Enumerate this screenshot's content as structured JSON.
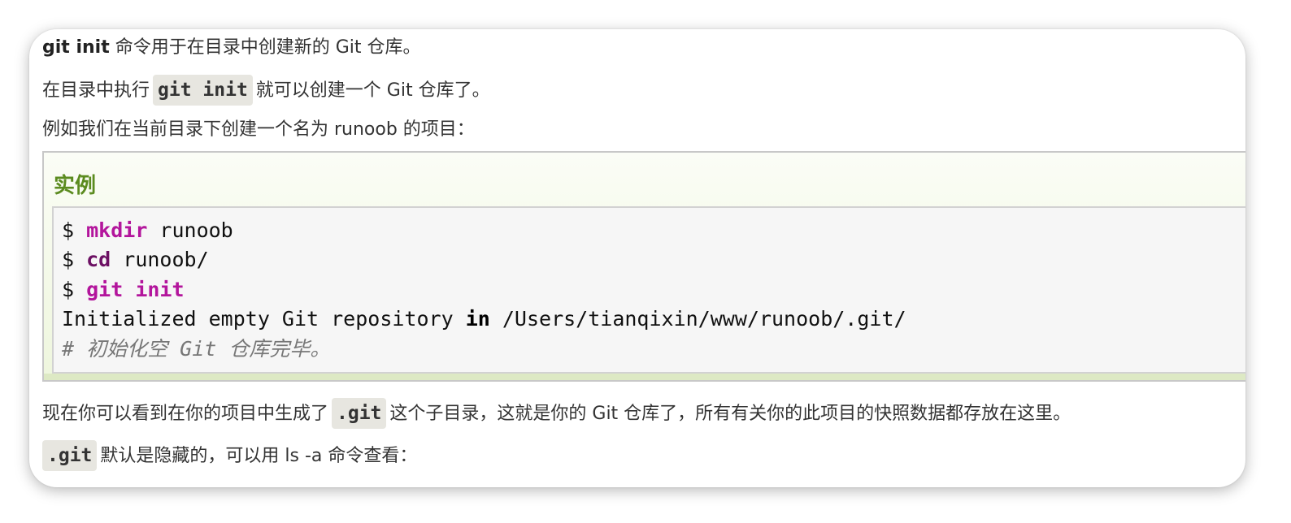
{
  "paragraphs": {
    "p1": {
      "bold": "git init",
      "text": " 命令用于在目录中创建新的 Git 仓库。"
    },
    "p2": {
      "before": "在目录中执行",
      "code": "git init",
      "after": "就可以创建一个 Git 仓库了。"
    },
    "p3": {
      "text": "例如我们在当前目录下创建一个名为 runoob 的项目："
    },
    "p4": {
      "before": "现在你可以看到在你的项目中生成了",
      "code": ".git",
      "after": "这个子目录，这就是你的 Git 仓库了，所有有关你的此项目的快照数据都存放在这里。"
    },
    "p5": {
      "code": ".git",
      "after": "默认是隐藏的，可以用 ls -a 命令查看："
    }
  },
  "example": {
    "title": "实例",
    "lines": [
      {
        "prompt": "$ ",
        "cmd": "mkdir",
        "rest": " runoob"
      },
      {
        "prompt": "$ ",
        "cmd": "cd",
        "rest": " runoob/"
      },
      {
        "prompt": "$ ",
        "cmd": "git init",
        "rest": ""
      },
      {
        "before": "Initialized empty Git repository ",
        "kw": "in",
        "after": " /Users/tianqixin/www/runoob/.git/"
      },
      {
        "comment": "# 初始化空 Git 仓库完毕。"
      }
    ]
  },
  "colors": {
    "accent_title": "#5b8b1f",
    "code_builtin": "#b3159c",
    "code_keyword": "#6c1063",
    "comment": "#777777"
  }
}
